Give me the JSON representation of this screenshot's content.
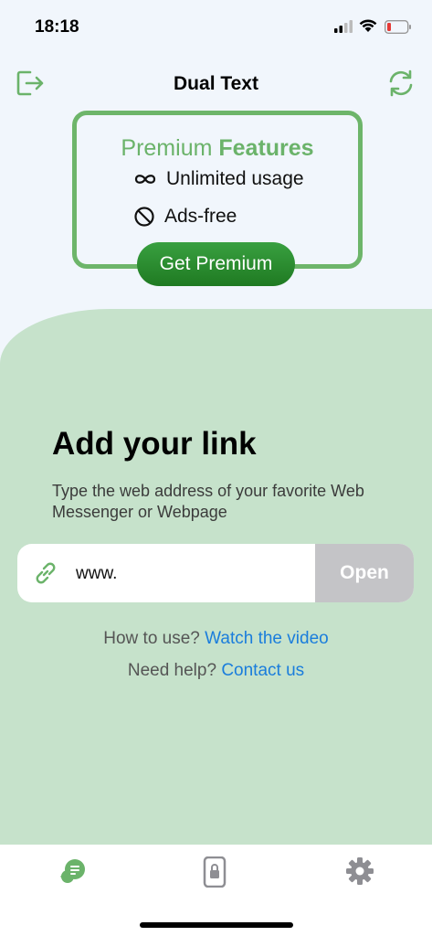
{
  "status_bar": {
    "time": "18:18"
  },
  "header": {
    "title": "Dual Text",
    "logout_icon": "logout-icon",
    "refresh_icon": "refresh-icon"
  },
  "premium": {
    "title_part1": "Premium ",
    "title_part2": "Features",
    "features": [
      {
        "icon": "infinity-icon",
        "label": "Unlimited usage"
      },
      {
        "icon": "block-icon",
        "label": "Ads-free"
      }
    ],
    "button_label": "Get Premium"
  },
  "main": {
    "heading": "Add your link",
    "description": "Type the web address of your favorite Web Messenger or Webpage",
    "url_value": "www.",
    "open_label": "Open",
    "help_prefix_1": "How to use? ",
    "help_link_1": "Watch the video",
    "help_prefix_2": "Need help? ",
    "help_link_2": "Contact us"
  },
  "tabs": [
    {
      "icon": "chat-icon",
      "active": true
    },
    {
      "icon": "phone-lock-icon",
      "active": false
    },
    {
      "icon": "settings-gear-icon",
      "active": false
    }
  ],
  "colors": {
    "accent": "#6bb36a",
    "button": "#2b8c30",
    "link": "#1a7ddc",
    "panel": "#c6e2cb"
  }
}
